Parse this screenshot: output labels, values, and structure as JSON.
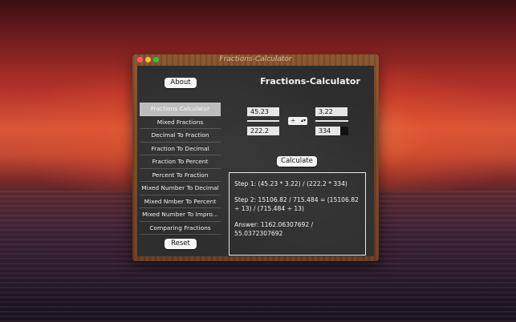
{
  "window": {
    "title": "Fractions-Calculator"
  },
  "header": {
    "app_title": "Fractions-Calculator"
  },
  "buttons": {
    "about": "About",
    "reset": "Reset",
    "calculate": "Calculate"
  },
  "sidebar": {
    "items": [
      {
        "label": "Fractions Calculator",
        "selected": true
      },
      {
        "label": "Mixed Fractions"
      },
      {
        "label": "Decimal To Fraction"
      },
      {
        "label": "Fraction To Decimal"
      },
      {
        "label": "Fraction To Percent"
      },
      {
        "label": "Percent To Fraction"
      },
      {
        "label": "Mixed Number To Decimal"
      },
      {
        "label": "Mixed Nmber To Percent"
      },
      {
        "label": "Mixed Number To Impro..."
      },
      {
        "label": "Comparing Fractions"
      }
    ]
  },
  "calculator": {
    "fraction1": {
      "numerator": "45.23",
      "denominator": "222.2"
    },
    "operator": "÷",
    "fraction2": {
      "numerator": "3.22",
      "denominator": "334"
    }
  },
  "result": {
    "step1": "Step 1:  (45.23 * 3.22) / (222.2 * 334)",
    "step2": "Step 2:  15106.82 / 715.484 = (15106.82 ÷ 13) / (715.484 ÷ 13)",
    "answer": "Answer:  1162.06307692 / 55.0372307692"
  }
}
